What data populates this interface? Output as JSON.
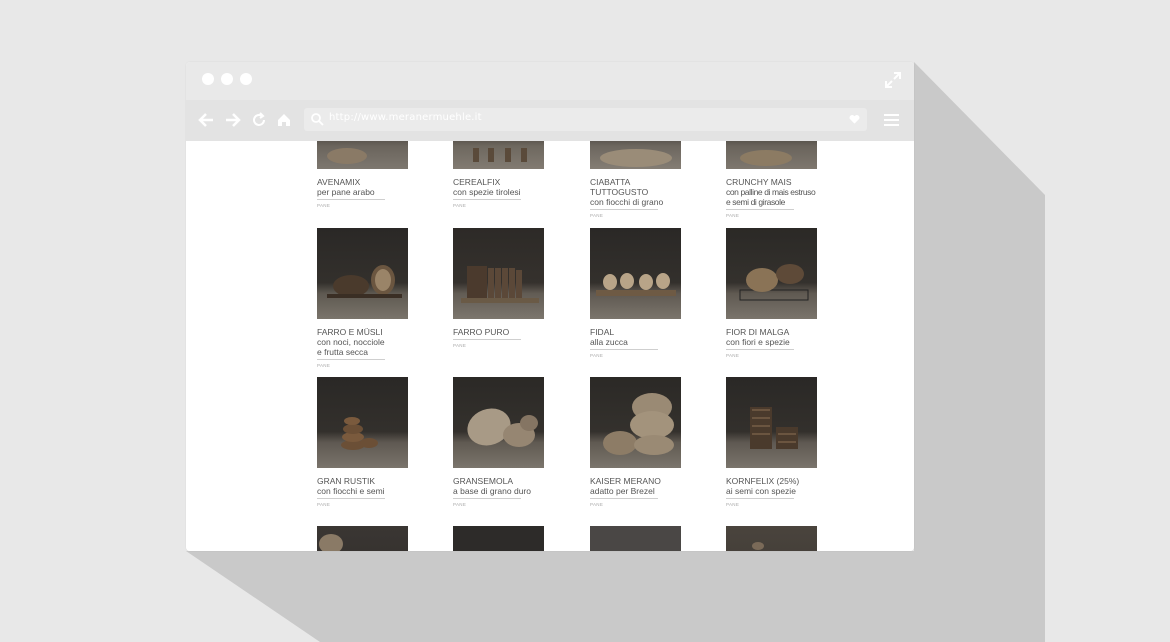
{
  "browser": {
    "url": "http://www.meranermuehle.it"
  },
  "products": [
    {
      "name": "AVENAMIX",
      "desc": "per pane arabo",
      "category": "PANE"
    },
    {
      "name": "CEREALFIX",
      "desc": "con spezie tirolesi",
      "category": "PANE"
    },
    {
      "name": "CIABATTA\nTUTTOGUSTO",
      "desc": "con fiocchi di grano",
      "category": "PANE"
    },
    {
      "name": "CRUNCHY MAIS",
      "desc": "con palline di mais estruso\ne semi di girasole",
      "category": "PANE"
    },
    {
      "name": "FARRO E MÜSLI",
      "desc": "con noci, nocciole\ne frutta secca",
      "category": "PANE"
    },
    {
      "name": "FARRO PURO",
      "desc": "",
      "category": "PANE"
    },
    {
      "name": "FIDAL",
      "desc": "alla zucca",
      "category": "PANE"
    },
    {
      "name": "FIOR DI MALGA",
      "desc": "con fiori e spezie",
      "category": "PANE"
    },
    {
      "name": "GRAN RUSTIK",
      "desc": "con fiocchi e semi",
      "category": "PANE"
    },
    {
      "name": "GRANSEMOLA",
      "desc": "a base di grano duro",
      "category": "PANE"
    },
    {
      "name": "KAISER MERANO",
      "desc": "adatto per Brezel",
      "category": "PANE"
    },
    {
      "name": "KORNFELIX (25%)",
      "desc": "ai semi con spezie",
      "category": "PANE"
    }
  ],
  "colors": {
    "background": "#e8e8e8",
    "titlebar": "#e9e9e9",
    "toolbar": "#e3e3e3",
    "text": "#555555"
  }
}
